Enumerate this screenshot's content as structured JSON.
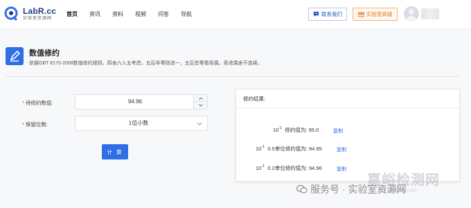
{
  "header": {
    "logo_title": "LabR.cc",
    "logo_sub": "实验室资源网",
    "nav": [
      "首页",
      "资讯",
      "资料",
      "视频",
      "问答",
      "导航"
    ],
    "contact_label": "联系我们",
    "mall_label": "实验室商城"
  },
  "page": {
    "title": "数值修约",
    "description": "依据GBT 8170-2008数值修约规则，四舍六入五考虑，五后非零则进一，五后皆零看奇偶，奇进偶舍不连续。"
  },
  "form": {
    "value_label": "待修约数值:",
    "value": "94.96",
    "digits_label": "保留位数:",
    "digits_selected": "1位小数",
    "submit_label": "计 算",
    "required_mark": "*"
  },
  "result": {
    "title": "修约结果:",
    "rows": [
      {
        "base": "10",
        "exp": "-1",
        "text": "修约值为: 95.0",
        "copy": "复制"
      },
      {
        "base": "10",
        "exp": "-1",
        "text": "0.5单位修约值为: 94.95",
        "copy": "复制"
      },
      {
        "base": "10",
        "exp": "-1",
        "text": "0.2单位修约值为: 94.96",
        "copy": "复制"
      }
    ]
  },
  "watermark": {
    "brand": "嘉峪检测网",
    "english": "AnyTesting.com",
    "service": "服务号 · 实验室资源网"
  },
  "colors": {
    "primary": "#2f6fe6",
    "brand_dark": "#1f3a8a",
    "mall_orange": "#e07b1e",
    "required_red": "#e44444"
  }
}
